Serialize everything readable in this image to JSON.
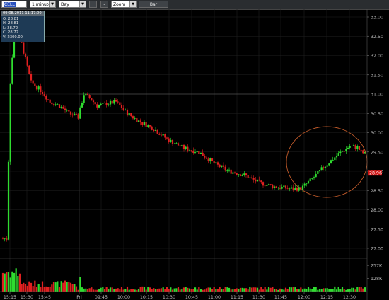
{
  "toolbar": {
    "symbol": "CELL",
    "interval": "1 minute",
    "range": "Day",
    "zoom_in": "+",
    "zoom_out": "-",
    "zoom_mode": "Zoom",
    "chart_type": "Bar"
  },
  "info_box": {
    "header": "09.08.2011 11:17:00",
    "open": "O: 28.81",
    "high": "H: 28.81",
    "low": "L: 28.72",
    "close": "C: 28.72",
    "volume": "V: 2300.00"
  },
  "colors": {
    "up": "#2fdc2f",
    "down": "#e02020",
    "price_tag": "#d01010",
    "annotation_circle": "#c05a2a",
    "background": "#000000",
    "grid": "#1f1f1f"
  },
  "last_price_tag": "28.96",
  "chart_data": {
    "type": "candlestick",
    "price_axis": {
      "ticks": [
        "33.00",
        "32.50",
        "32.00",
        "31.50",
        "31.00",
        "30.50",
        "30.00",
        "29.50",
        "29.00",
        "28.50",
        "28.00",
        "27.50",
        "27.00"
      ],
      "range": [
        26.8,
        33.1
      ]
    },
    "volume_axis": {
      "ticks": [
        "257K",
        "128K"
      ],
      "max": 300000
    },
    "time_axis": [
      "15:15",
      "15:30",
      "15:45",
      "Fri",
      "09:45",
      "10:00",
      "10:15",
      "10:30",
      "10:45",
      "11:00",
      "11:15",
      "11:30",
      "11:45",
      "12:00",
      "12:15",
      "12:30"
    ],
    "horizontal_line": 31.0,
    "price_path": [
      [
        0,
        27.25
      ],
      [
        2,
        27.25
      ],
      [
        4,
        31.3
      ],
      [
        6,
        32.6
      ],
      [
        8,
        32.85
      ],
      [
        10,
        32.3
      ],
      [
        12,
        31.9
      ],
      [
        15,
        31.3
      ],
      [
        20,
        31.1
      ],
      [
        25,
        30.8
      ],
      [
        30,
        30.7
      ],
      [
        35,
        30.5
      ],
      [
        40,
        30.4
      ],
      [
        43,
        31.0
      ],
      [
        46,
        30.9
      ],
      [
        50,
        30.7
      ],
      [
        55,
        30.75
      ],
      [
        60,
        30.8
      ],
      [
        66,
        30.5
      ],
      [
        72,
        30.3
      ],
      [
        80,
        30.1
      ],
      [
        88,
        29.8
      ],
      [
        96,
        29.6
      ],
      [
        104,
        29.5
      ],
      [
        112,
        29.2
      ],
      [
        120,
        29.0
      ],
      [
        128,
        28.9
      ],
      [
        136,
        28.7
      ],
      [
        144,
        28.6
      ],
      [
        152,
        28.55
      ],
      [
        158,
        28.55
      ],
      [
        164,
        28.8
      ],
      [
        170,
        29.1
      ],
      [
        178,
        29.45
      ],
      [
        184,
        29.65
      ],
      [
        188,
        29.62
      ],
      [
        190,
        29.5
      ],
      [
        192,
        29.45
      ]
    ]
  }
}
